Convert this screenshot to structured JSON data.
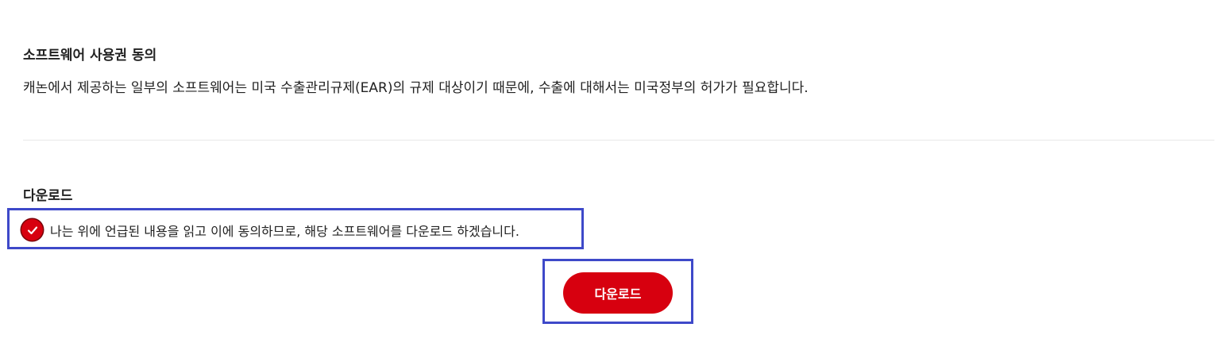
{
  "license": {
    "title": "소프트웨어 사용권 동의",
    "description": "캐논에서 제공하는 일부의 소프트웨어는 미국 수출관리규제(EAR)의 규제 대상이기 때문에, 수출에 대해서는 미국정부의 허가가 필요합니다."
  },
  "download": {
    "title": "다운로드",
    "agree_text": "나는 위에 언급된 내용을 읽고 이에 동의하므로, 해당 소프트웨어를 다운로드 하겠습니다.",
    "agree_checked": true,
    "button_label": "다운로드",
    "check_icon": "checkmark-icon"
  },
  "colors": {
    "accent": "#d7000f",
    "highlight_border": "#3e49c9",
    "divider": "#e8e8e8"
  }
}
